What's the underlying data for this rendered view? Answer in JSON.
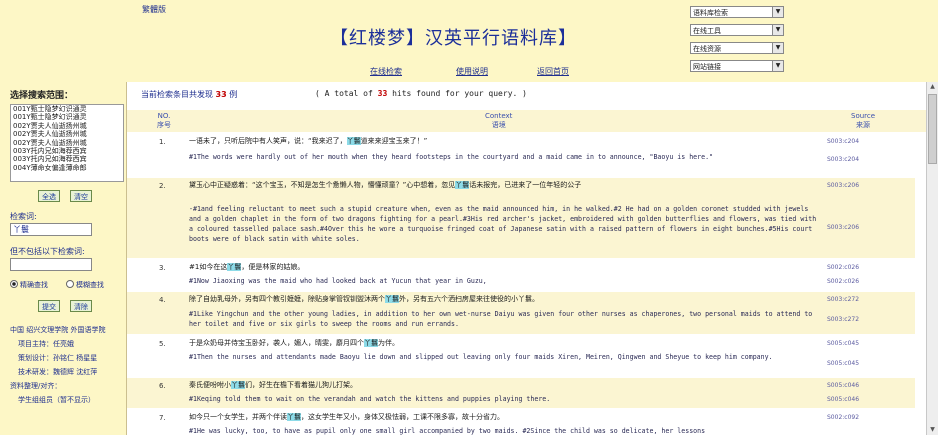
{
  "top_link": "繁體版",
  "title": "【红楼梦】汉英平行语料库】",
  "nav": [
    "在线检索",
    "使用说明",
    "返回首页"
  ],
  "selects": [
    "语料库检索",
    "在线工具",
    "在线资源",
    "网站链接"
  ],
  "sidebar": {
    "title": "选择搜索范围：",
    "list": [
      "001Y甄士隐梦幻识通灵",
      "001Y甄士隐梦幻识通灵",
      "002Y贾夫人仙逝扬州城",
      "002Y贾夫人仙逝扬州城",
      "002Y贾夫人仙逝扬州城",
      "003Y托内兄如海荐西宾",
      "003Y托内兄如海荐西宾",
      "004Y薄命女偏逢薄命郎"
    ],
    "select_all": "全选",
    "clear": "清空",
    "keyword_label": "检索词:",
    "keyword_value": "丫鬟",
    "exclude_label": "但不包括以下检索词:",
    "exclude_value": "",
    "radio_precise": "精确查找",
    "radio_fuzzy": "模糊查找",
    "submit": "提交",
    "reset": "清除",
    "credits": [
      "中国 绍兴文理学院 外国语学院",
      "项目主持：任亮娥",
      "策划设计：孙铭仁 杨星星",
      "技术研发：魏德辉 沈红萍",
      "资料整理/对齐：",
      "学生组组员（暂不显示）"
    ]
  },
  "summary": {
    "prefix": "当前检索条目共发现",
    "count": "33",
    "suffix": "例",
    "en_prefix": "( A total of",
    "en_suffix": "hits found for your query. )"
  },
  "table": {
    "col_no_en": "NO.",
    "col_no_zh": "序号",
    "col_context_en": "Context",
    "col_context_zh": "语境",
    "col_source_en": "Source",
    "col_source_zh": "来源"
  },
  "rows": [
    {
      "no": "1.",
      "zh": "一语未了，只听后院中有人笑声，说：“我来迟了，",
      "hl": "丫鬟",
      "zh2": "道来来迎宝玉来了！”",
      "en": "#1The words were hardly out of her mouth when they heard footsteps in the courtyard and a maid came in to announce, \"Baoyu is here.\"",
      "src1": "S003:c204",
      "src2": "S003:c204"
    },
    {
      "no": "2.",
      "zh": "黛玉心中正疑惑着：“这个宝玉，不知是怎生个惫懒人物，懵懂顽童？”心中想着，忽见",
      "hl": "丫鬟",
      "zh2": "话未报完，已进来了一位年轻的公子",
      "en": "-#1and feeling reluctant to meet such a stupid creature when, even as the maid announced him, in he walked.#2 He had on a golden coronet studded with jewels and a golden chaplet in the form of two dragons fighting for a pearl.#3His red archer's jacket, embroidered with golden butterflies and flowers, was tied with a coloured tasselled palace sash.#4Over this he wore a turquoise fringed coat of Japanese satin with a raised pattern of flowers in eight bunches.#5His court boots were of black satin with white soles.",
      "src1": "S003:c206",
      "src2": "S003:c206"
    },
    {
      "no": "3.",
      "zh": "#1如今在这",
      "hl": "丫鬟",
      "zh2": "，便是林家的姑娘。",
      "en": "#1Now Jiaoxing was the maid who had looked back at Yucun that year in Guzu,",
      "src1": "S002:c026",
      "src2": "S002:c026"
    },
    {
      "no": "4.",
      "zh": "除了自幼乳母外，另有四个教引嬷嬷，除贴身掌管钗钏盥沐两个",
      "hl": "丫鬟",
      "zh2": "外，另有五六个洒扫房屋来往使役的小丫鬟。",
      "en": "#1Like Yingchun and the other young ladies, in addition to her own wet-nurse Daiyu was given four other nurses as chaperones, two personal maids to attend to her toilet and five or six girls to sweep the rooms and run errands.",
      "src1": "S003:c272",
      "src2": "S003:c272"
    },
    {
      "no": "5.",
      "zh": "于是众奶母并侍宝玉卧好，袭人，媚人，晴雯，麝月四个",
      "hl": "丫鬟",
      "zh2": "为伴。",
      "en": "#1Then the nurses and attendants made Baoyu lie down and slipped out leaving only four maids Xiren, Meiren, Qingwen and Sheyue to keep him company.",
      "src1": "S005:c045",
      "src2": "S005:c045"
    },
    {
      "no": "6.",
      "zh": "秦氏便吩咐小",
      "hl": "丫鬟",
      "zh2": "们，好生在檐下看着猫儿狗儿打架。",
      "en": "#1Keqing told them to wait on the verandah and watch the kittens and puppies playing there.",
      "src1": "S005:c046",
      "src2": "S005:c046"
    },
    {
      "no": "7.",
      "zh": "如今只一个女学生，并两个伴读",
      "hl": "丫鬟",
      "zh2": "，这女学生年又小，身体又极怯弱，工课不限多寡，故十分省力。",
      "en": "#1He was lucky, too, to have as pupil only one small girl accompanied by two maids. #2Since the child was so delicate, her lessons",
      "src1": "S002:c092",
      "src2": ""
    }
  ]
}
